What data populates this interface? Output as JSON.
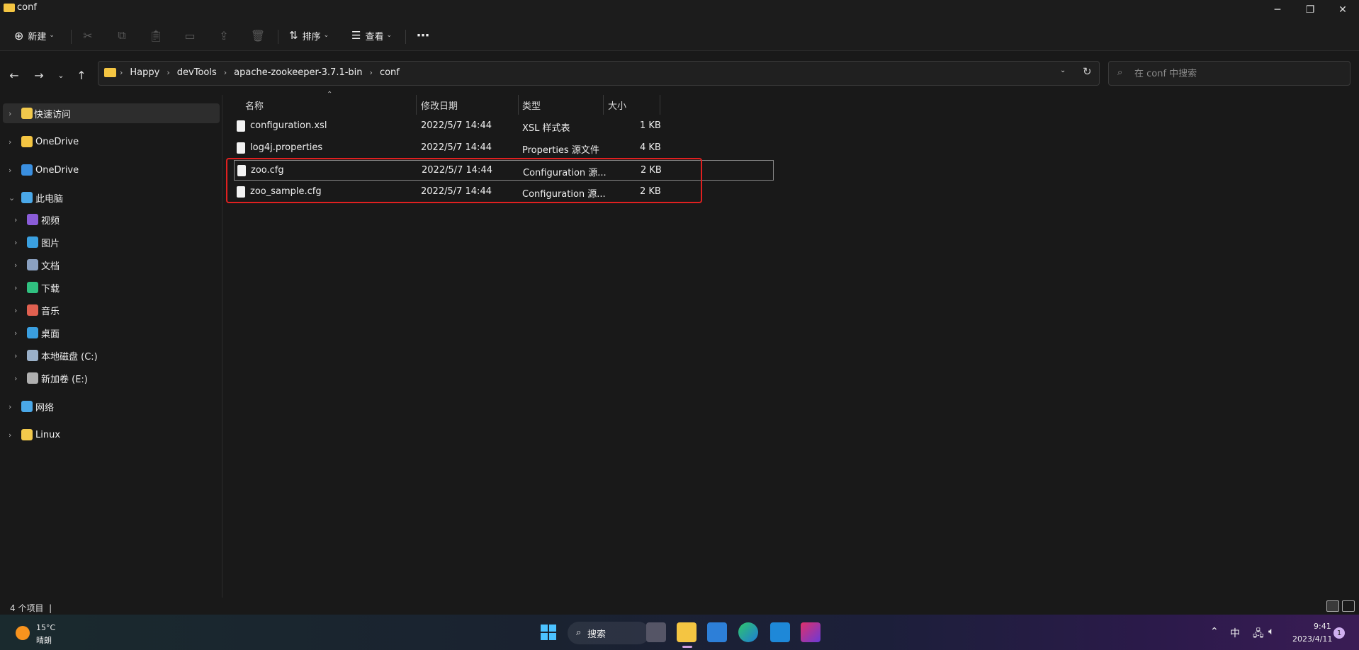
{
  "window": {
    "title": "conf"
  },
  "toolbar": {
    "new_label": "新建",
    "sort_label": "排序",
    "view_label": "查看",
    "more_label": "⋯"
  },
  "address": {
    "crumbs": [
      "Happy",
      "devTools",
      "apache-zookeeper-3.7.1-bin",
      "conf"
    ]
  },
  "search": {
    "placeholder": "在 conf 中搜索"
  },
  "sidebar": {
    "items": [
      {
        "label": "快速访问",
        "icon": "star-icon",
        "color": "#f2c94c"
      },
      {
        "label": "OneDrive",
        "icon": "folder-icon",
        "color": "#f4c542"
      },
      {
        "label": "OneDrive",
        "icon": "cloud-icon",
        "color": "#3a8fe0"
      },
      {
        "label": "此电脑",
        "icon": "computer-icon",
        "color": "#4aa8e8"
      },
      {
        "label": "视频",
        "icon": "video-icon",
        "color": "#8a5cd8"
      },
      {
        "label": "图片",
        "icon": "picture-icon",
        "color": "#3aa0e0"
      },
      {
        "label": "文档",
        "icon": "document-icon",
        "color": "#8aa0c0"
      },
      {
        "label": "下载",
        "icon": "download-icon",
        "color": "#30c080"
      },
      {
        "label": "音乐",
        "icon": "music-icon",
        "color": "#e06050"
      },
      {
        "label": "桌面",
        "icon": "desktop-icon",
        "color": "#3a9fe0"
      },
      {
        "label": "本地磁盘 (C:)",
        "icon": "drive-icon",
        "color": "#9ab0c8"
      },
      {
        "label": "新加卷 (E:)",
        "icon": "drive-icon",
        "color": "#b0b0b0"
      },
      {
        "label": "网络",
        "icon": "network-icon",
        "color": "#4aa8e8"
      },
      {
        "label": "Linux",
        "icon": "linux-icon",
        "color": "#f2c94c"
      }
    ]
  },
  "columns": {
    "name": "名称",
    "modified": "修改日期",
    "type": "类型",
    "size": "大小"
  },
  "files": [
    {
      "name": "configuration.xsl",
      "modified": "2022/5/7 14:44",
      "type": "XSL 样式表",
      "size": "1 KB"
    },
    {
      "name": "log4j.properties",
      "modified": "2022/5/7 14:44",
      "type": "Properties 源文件",
      "size": "4 KB"
    },
    {
      "name": "zoo.cfg",
      "modified": "2022/5/7 14:44",
      "type": "Configuration 源...",
      "size": "2 KB"
    },
    {
      "name": "zoo_sample.cfg",
      "modified": "2022/5/7 14:44",
      "type": "Configuration 源...",
      "size": "2 KB"
    }
  ],
  "status": {
    "count": "4 个项目"
  },
  "taskbar": {
    "weather_temp": "15°C",
    "weather_desc": "晴朗",
    "search_label": "搜索",
    "ime": "中",
    "time": "9:41",
    "date": "2023/4/11",
    "notifications": "1"
  }
}
